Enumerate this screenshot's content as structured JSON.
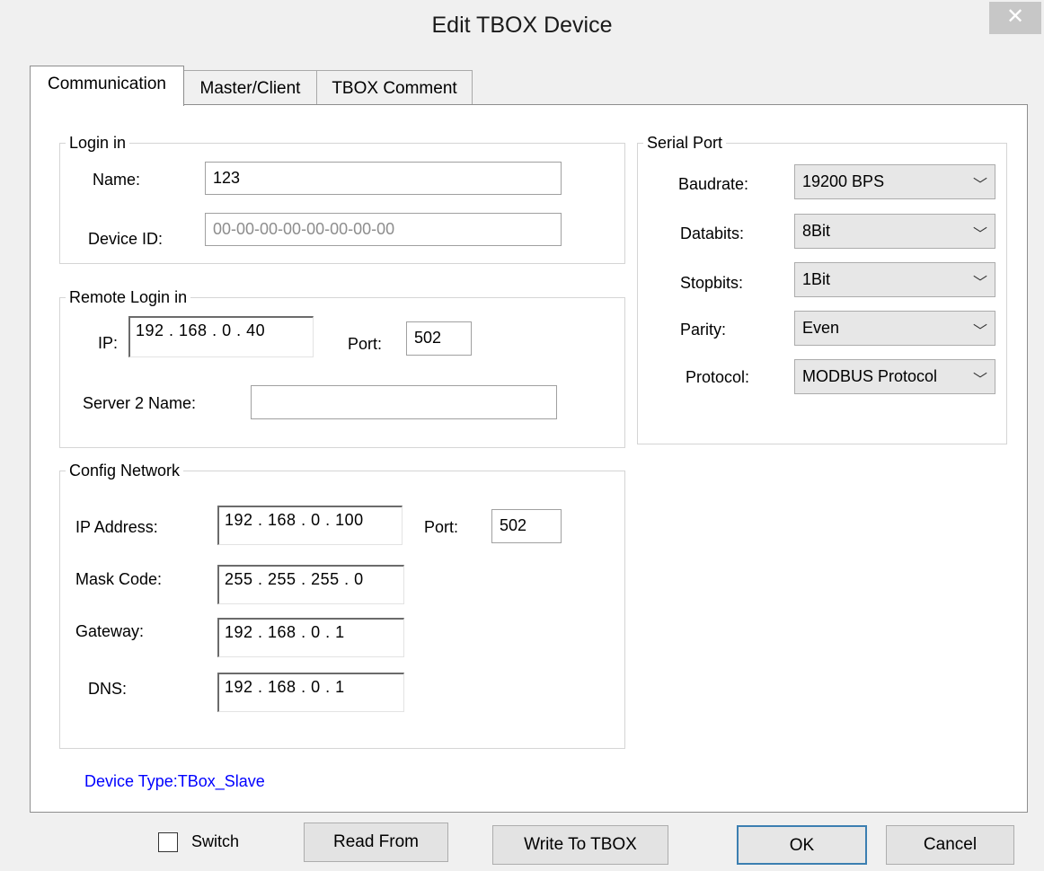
{
  "window": {
    "title": "Edit TBOX Device",
    "close_glyph": "✕"
  },
  "tabs": [
    {
      "label": "Communication",
      "active": true
    },
    {
      "label": "Master/Client",
      "active": false
    },
    {
      "label": "TBOX Comment",
      "active": false
    }
  ],
  "login": {
    "group_label": "Login in",
    "name_label": "Name:",
    "name_value": "123",
    "device_id_label": "Device ID:",
    "device_id_value": "00-00-00-00-00-00-00-00"
  },
  "remote_login": {
    "group_label": "Remote Login in",
    "ip_label": "IP:",
    "ip_value": "192 . 168 .  0  .  40",
    "port_label": "Port:",
    "port_value": "502",
    "server2_label": "Server 2 Name:",
    "server2_value": ""
  },
  "config_network": {
    "group_label": "Config Network",
    "ip_label": "IP Address:",
    "ip_value": "192 . 168 .  0  . 100",
    "port_label": "Port:",
    "port_value": "502",
    "mask_label": "Mask Code:",
    "mask_value": "255 . 255 . 255 .  0",
    "gateway_label": "Gateway:",
    "gateway_value": "192 . 168 .  0  .  1",
    "dns_label": "DNS:",
    "dns_value": "192 . 168 .  0  .  1"
  },
  "serial_port": {
    "group_label": "Serial Port",
    "baudrate_label": "Baudrate:",
    "baudrate_value": "19200 BPS",
    "databits_label": "Databits:",
    "databits_value": "8Bit",
    "stopbits_label": "Stopbits:",
    "stopbits_value": "1Bit",
    "parity_label": "Parity:",
    "parity_value": "Even",
    "protocol_label": "Protocol:",
    "protocol_value": "MODBUS Protocol"
  },
  "device_type": "Device Type:TBox_Slave",
  "colors": {
    "device_type": "#0000ff",
    "default_button_border": "#3c7fb1"
  },
  "footer": {
    "switch_label": "Switch",
    "switch_checked": false,
    "read_from": "Read From",
    "write_to": "Write To TBOX",
    "ok": "OK",
    "cancel": "Cancel"
  }
}
